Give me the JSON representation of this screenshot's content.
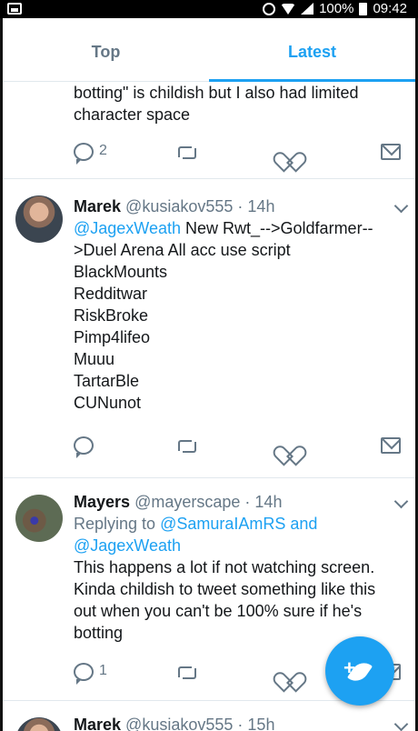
{
  "status_bar": {
    "battery": "100%",
    "time": "09:42"
  },
  "tabs": [
    {
      "label": "Top",
      "active": false
    },
    {
      "label": "Latest",
      "active": true
    }
  ],
  "colors": {
    "accent": "#1da1f2",
    "muted": "#657786",
    "text": "#14171a"
  },
  "tweets": [
    {
      "partial": true,
      "text_lines": [
        "botting\" is childish but I also had limited",
        "character space"
      ],
      "reply_count": "2"
    },
    {
      "name": "Marek",
      "handle": "@kusiakov555",
      "dot": "·",
      "time": "14h",
      "mention": "@JagexWeath",
      "text_first": " New Rwt_-->Goldfarmer--",
      "text_lines": [
        ">Duel Arena All acc use script",
        "BlackMounts",
        "Redditwar",
        "RiskBroke",
        "Pimp4lifeo",
        "Muuu",
        "TartarBle",
        "CUNunot"
      ],
      "reply_count": ""
    },
    {
      "name": "Mayers",
      "handle": "@mayerscape",
      "dot": "·",
      "time": "14h",
      "reply_prefix": "Replying to ",
      "reply_mention_1": "@SamuraIAmRS",
      "reply_and": " and",
      "reply_mention_2": "@JagexWeath",
      "text_lines": [
        "This happens a lot if not watching screen.",
        "Kinda childish to tweet something like this",
        "out when you can't be 100% sure if he's",
        "botting"
      ],
      "reply_count": "1"
    },
    {
      "name": "Marek",
      "handle": "@kusiakov555",
      "dot": "·",
      "time": "15h"
    }
  ],
  "icons": {
    "reply": "reply-icon",
    "retweet": "retweet-icon",
    "like": "like-icon",
    "message": "message-icon",
    "compose": "compose-tweet-icon"
  }
}
